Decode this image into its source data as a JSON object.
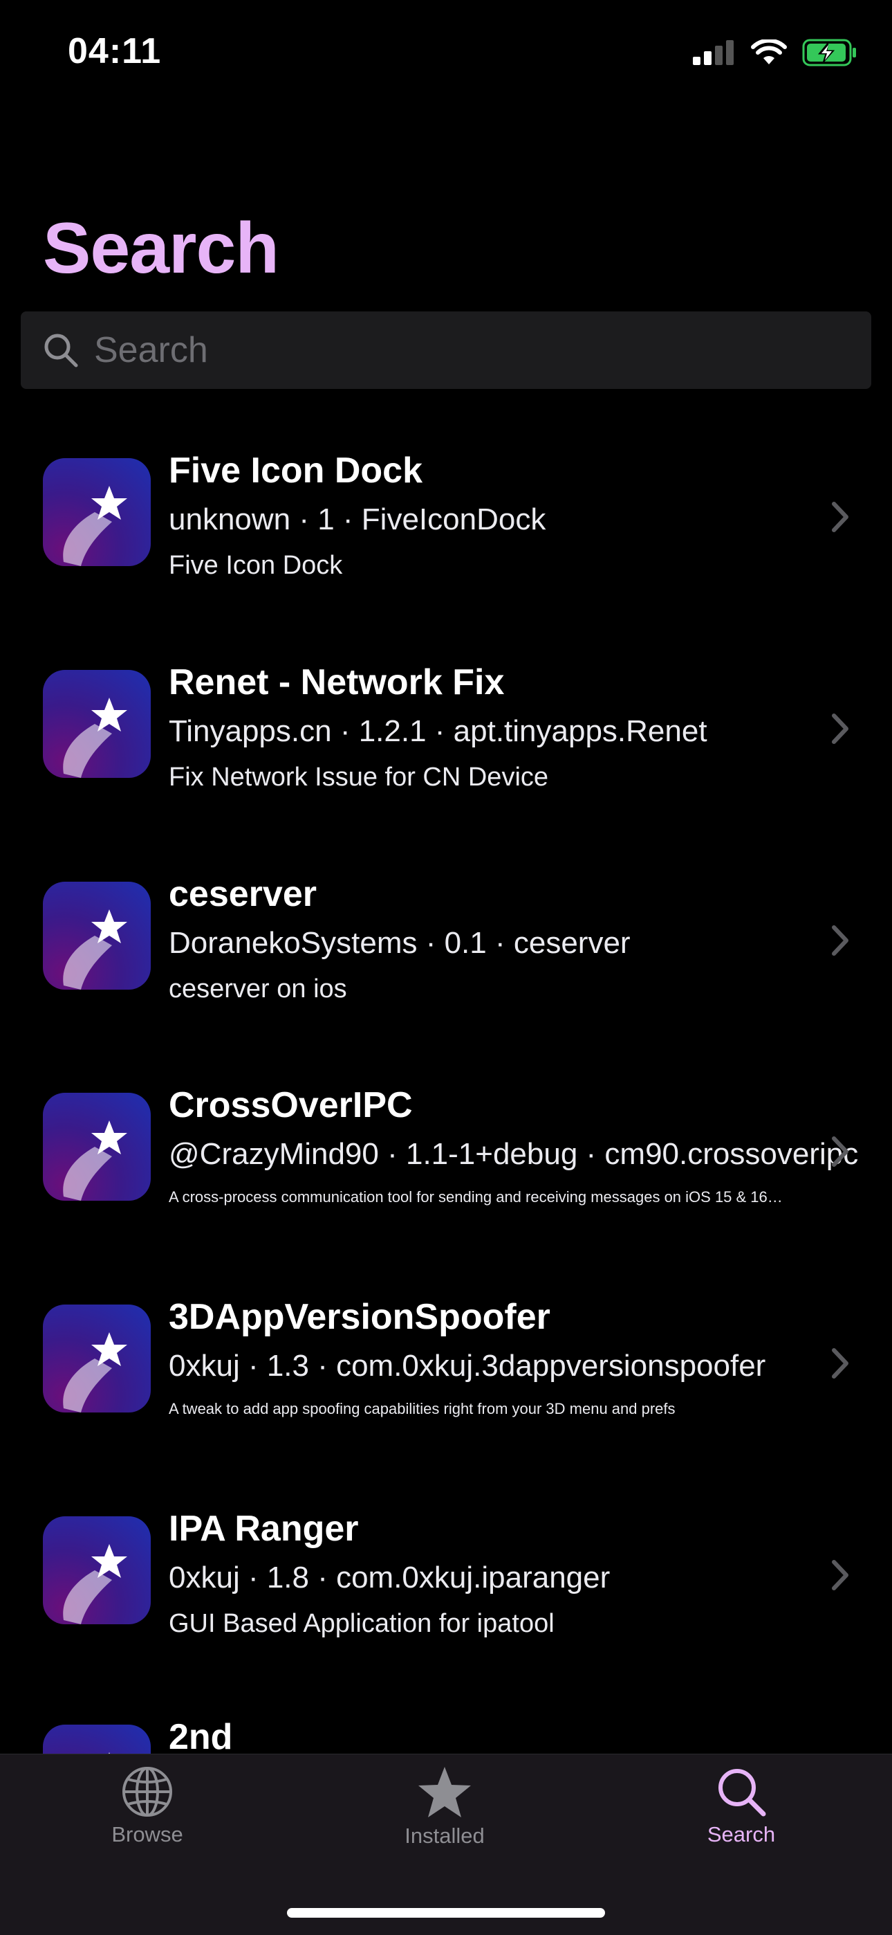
{
  "status": {
    "time": "04:11"
  },
  "title": "Search",
  "search": {
    "placeholder": "Search",
    "value": ""
  },
  "results": [
    {
      "title": "Five Icon Dock",
      "meta": "unknown · 1 · FiveIconDock",
      "desc": "Five Icon Dock"
    },
    {
      "title": "Renet - Network Fix",
      "meta": "Tinyapps.cn · 1.2.1 · apt.tinyapps.Renet",
      "desc": "Fix Network Issue for CN Device"
    },
    {
      "title": "ceserver",
      "meta": "DoranekoSystems · 0.1 · ceserver",
      "desc": "ceserver on ios"
    },
    {
      "title": "CrossOverIPC",
      "meta": "@CrazyMind90 · 1.1-1+debug · cm90.crossoveripc",
      "desc": "A cross-process communication tool for sending and receiving messages on iOS 15 & 16…"
    },
    {
      "title": "3DAppVersionSpoofer",
      "meta": "0xkuj · 1.3 · com.0xkuj.3dappversionspoofer",
      "desc": "A tweak to add app spoofing capabilities right from your 3D menu and prefs"
    },
    {
      "title": "IPA Ranger",
      "meta": "0xkuj · 1.8 · com.0xkuj.iparanger",
      "desc": "GUI Based Application for ipatool"
    },
    {
      "title": "2nd",
      "meta": "",
      "desc": ""
    }
  ],
  "tabs": [
    {
      "label": "Browse",
      "icon": "globe-icon",
      "active": false
    },
    {
      "label": "Installed",
      "icon": "star-icon",
      "active": false
    },
    {
      "label": "Search",
      "icon": "search-icon",
      "active": true
    }
  ],
  "colors": {
    "accent": "#e7b4f7",
    "inactive": "#8e8e93",
    "battery": "#34c759"
  }
}
